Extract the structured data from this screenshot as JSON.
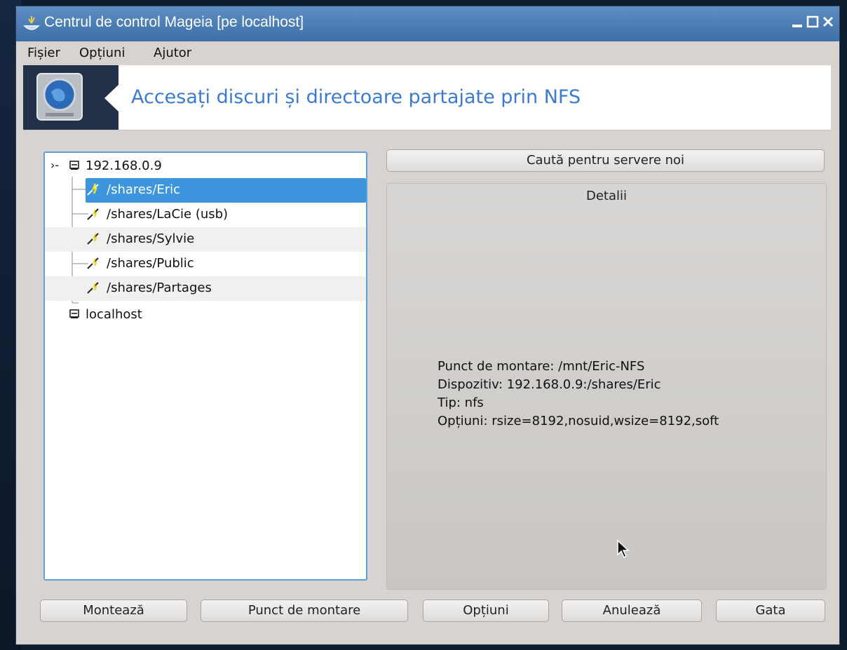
{
  "window": {
    "title": "Centrul de control Mageia  [pe localhost]"
  },
  "menu": {
    "items": [
      {
        "label": "Fișier"
      },
      {
        "label": "Opțiuni"
      },
      {
        "label": "Ajutor"
      }
    ]
  },
  "banner": {
    "heading": "Accesați discuri și directoare partajate prin NFS"
  },
  "tree": {
    "server": "192.168.0.9",
    "shares": [
      "/shares/Eric",
      "/shares/LaCie (usb)",
      "/shares/Sylvie",
      "/shares/Public",
      "/shares/Partages"
    ],
    "selected_index": 0,
    "localhost": "localhost"
  },
  "search_button": "Caută pentru servere noi",
  "details": {
    "title": "Detalii",
    "mount_point": "Punct de montare: /mnt/Eric-NFS",
    "device": "Dispozitiv: 192.168.0.9:/shares/Eric",
    "type": "Tip: nfs",
    "options": "Opțiuni: rsize=8192,nosuid,wsize=8192,soft"
  },
  "buttons": {
    "mount": "Montează",
    "mount_point": "Punct de montare",
    "options": "Opțiuni",
    "cancel": "Anulează",
    "done": "Gata"
  },
  "colors": {
    "titlebar": "#4a7db7",
    "selection": "#3d95dd",
    "heading": "#3b7bd1"
  }
}
